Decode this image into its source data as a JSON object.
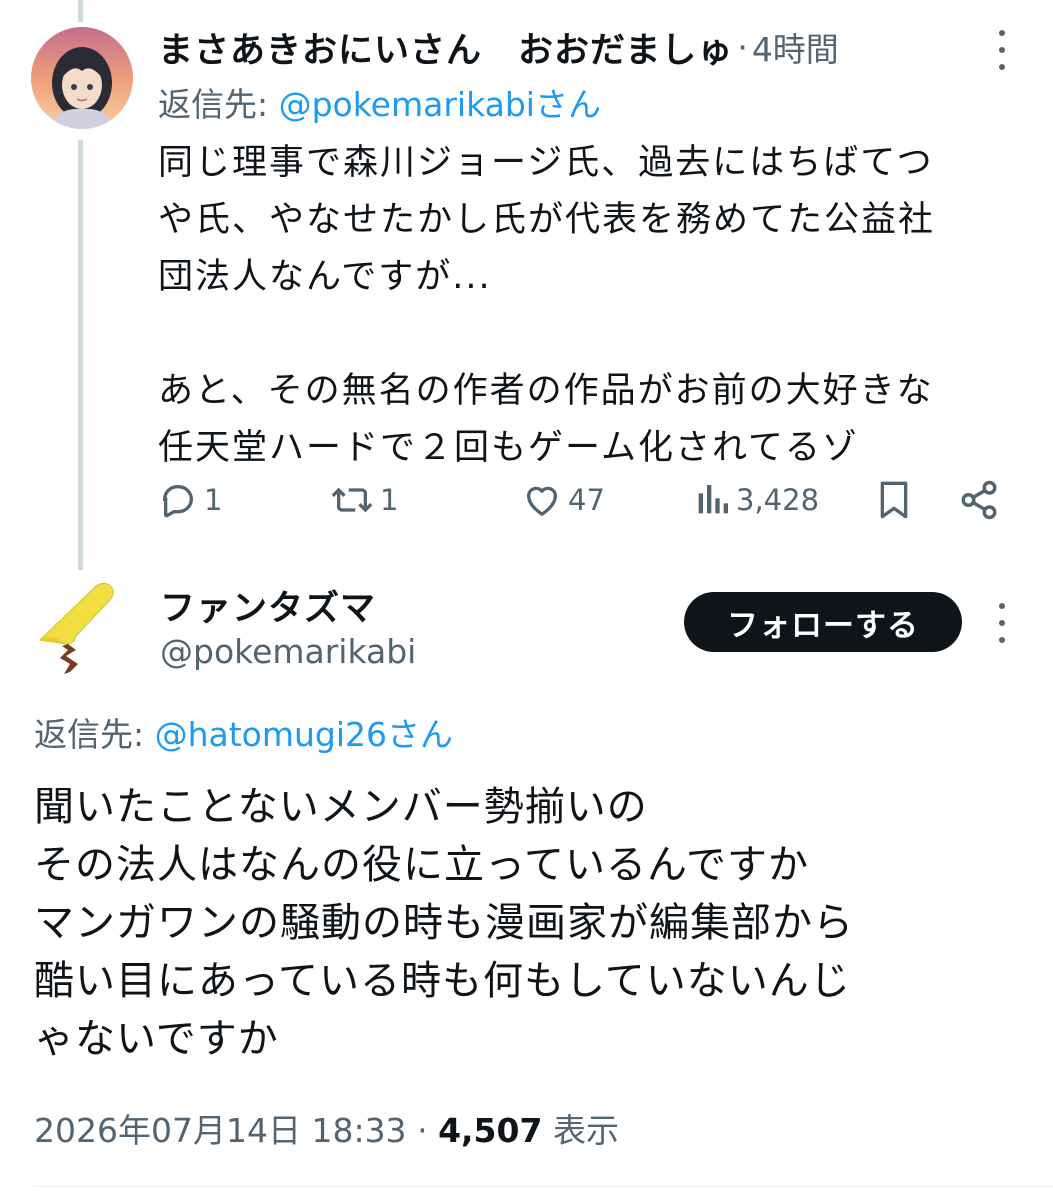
{
  "parent_tweet": {
    "display_name": "まさあきおにいさん　おおだましゅ",
    "separator": "·",
    "time": "4時間",
    "reply_prefix": "返信先: ",
    "reply_to": "@pokemarikabiさん",
    "body_para1": "同じ理事で森川ジョージ氏、過去にはちばてつ\nや氏、やなせたかし氏が代表を務めてた公益社\n団法人なんですが...",
    "body_para2": "あと、その無名の作者の作品がお前の大好きな\n任天堂ハードで２回もゲーム化されてるゾ",
    "actions": {
      "reply_count": "1",
      "repost_count": "1",
      "like_count": "47",
      "view_count": "3,428"
    },
    "icons": [
      "reply-icon",
      "repost-icon",
      "like-icon",
      "views-icon",
      "bookmark-icon",
      "share-icon",
      "more-icon"
    ]
  },
  "main_tweet": {
    "display_name": "ファンタズマ",
    "handle": "@pokemarikabi",
    "follow_label": "フォローする",
    "reply_prefix": "返信先: ",
    "reply_to": "@hatomugi26さん",
    "body": "聞いたことないメンバー勢揃いの\nその法人はなんの役に立っているんですか\nマンガワンの騒動の時も漫画家が編集部から\n酷い目にあっている時も何もしていないんじ\nゃないですか",
    "timestamp": "2026年07月14日 18:33",
    "separator": "·",
    "view_count": "4,507",
    "view_label": "表示"
  },
  "colors": {
    "text": "#0f1419",
    "muted": "#536471",
    "link": "#1d9bf0",
    "thread_line": "#cfd9de",
    "follow_bg": "#0f1419"
  }
}
